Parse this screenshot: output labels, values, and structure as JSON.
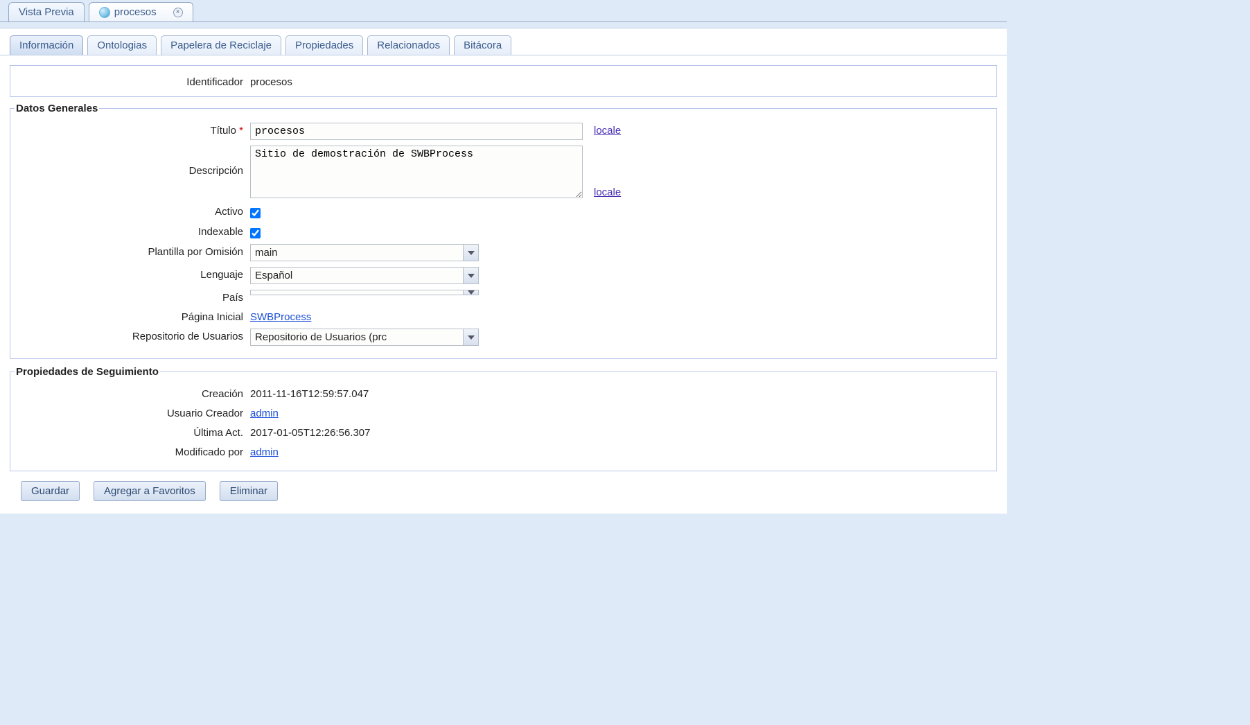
{
  "topTabs": {
    "preview": "Vista Previa",
    "procesos": "procesos"
  },
  "innerTabs": {
    "informacion": "Información",
    "ontologias": "Ontologias",
    "papelera": "Papelera de Reciclaje",
    "propiedades": "Propiedades",
    "relacionados": "Relacionados",
    "bitacora": "Bitácora"
  },
  "labels": {
    "identificador": "Identificador",
    "titulo": "Título",
    "descripcion": "Descripción",
    "activo": "Activo",
    "indexable": "Indexable",
    "plantilla": "Plantilla por Omisión",
    "lenguaje": "Lenguaje",
    "pais": "País",
    "paginaInicial": "Página Inicial",
    "repositorio": "Repositorio de Usuarios",
    "creacion": "Creación",
    "usuarioCreador": "Usuario Creador",
    "ultimaAct": "Última Act.",
    "modificadoPor": "Modificado por",
    "locale": "locale"
  },
  "fieldsets": {
    "datosGenerales": "Datos Generales",
    "seguimiento": "Propiedades de Seguimiento"
  },
  "values": {
    "identificador": "procesos",
    "titulo": "procesos",
    "descripcion": "Sitio de demostración de SWBProcess",
    "activo": true,
    "indexable": true,
    "plantilla": "main",
    "lenguaje": "Español",
    "pais": "",
    "paginaInicial": "SWBProcess",
    "repositorio": "Repositorio de Usuarios (prc",
    "creacion": "2011-11-16T12:59:57.047",
    "usuarioCreador": "admin",
    "ultimaAct": "2017-01-05T12:26:56.307",
    "modificadoPor": "admin"
  },
  "buttons": {
    "guardar": "Guardar",
    "favoritos": "Agregar a Favoritos",
    "eliminar": "Eliminar"
  }
}
